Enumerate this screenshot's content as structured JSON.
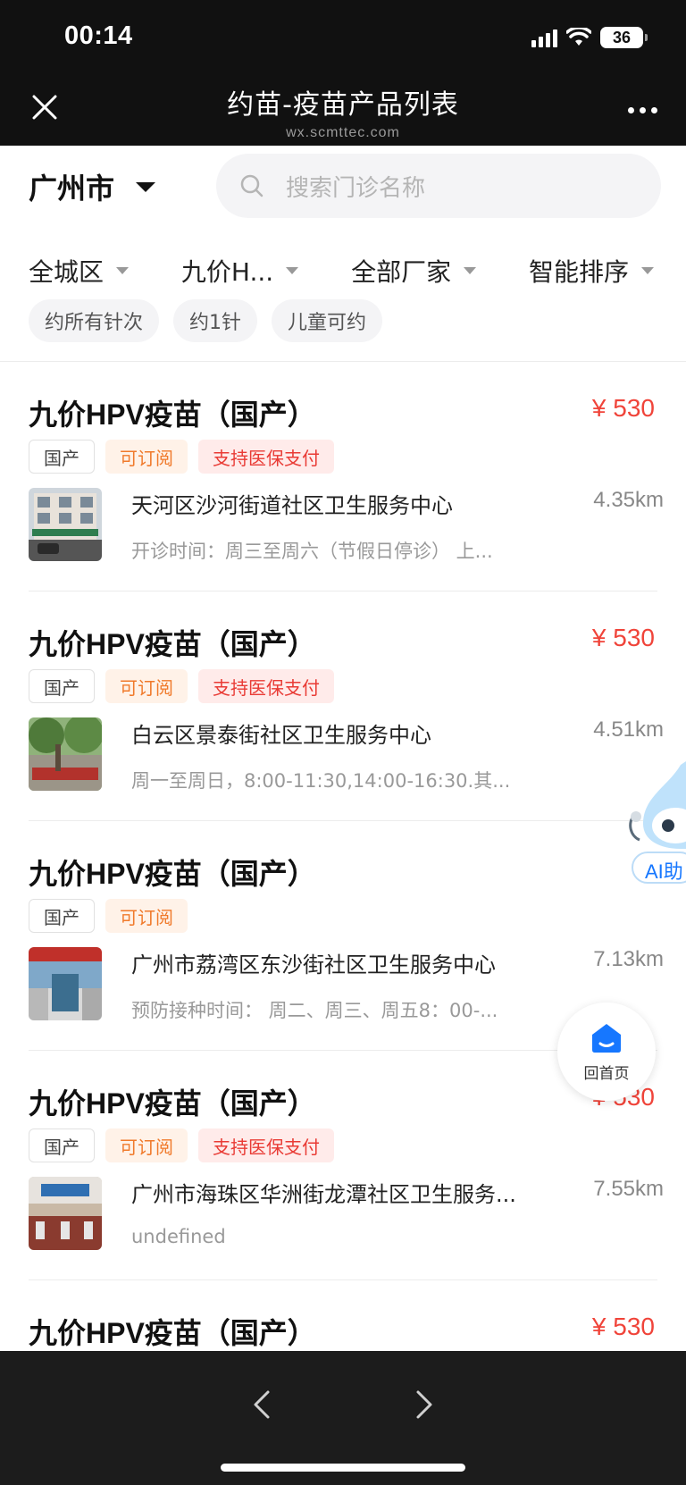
{
  "status_bar": {
    "time": "00:14",
    "battery": "36"
  },
  "header": {
    "title": "约苗-疫苗产品列表",
    "subtitle": "wx.scmttec.com"
  },
  "city": {
    "name": "广州市"
  },
  "search": {
    "placeholder": "搜索门诊名称"
  },
  "filters": [
    {
      "label": "全城区"
    },
    {
      "label": "九价H..."
    },
    {
      "label": "全部厂家"
    },
    {
      "label": "智能排序"
    }
  ],
  "chips": [
    "约所有针次",
    "约1针",
    "儿童可约"
  ],
  "items": [
    {
      "product": "九价HPV疫苗（国产）",
      "price": "¥ 530",
      "tags": [
        "国产",
        "可订阅",
        "支持医保支付"
      ],
      "clinic": "天河区沙河街道社区卫生服务中心",
      "distance": "4.35km",
      "hours": "开诊时间：周三至周六（节假日停诊） 上..."
    },
    {
      "product": "九价HPV疫苗（国产）",
      "price": "¥ 530",
      "tags": [
        "国产",
        "可订阅",
        "支持医保支付"
      ],
      "clinic": "白云区景泰街社区卫生服务中心",
      "distance": "4.51km",
      "hours": "周一至周日，8:00-11:30,14:00-16:30.其..."
    },
    {
      "product": "九价HPV疫苗（国产）",
      "price": "",
      "tags": [
        "国产",
        "可订阅"
      ],
      "clinic": "广州市荔湾区东沙街社区卫生服务中心",
      "distance": "7.13km",
      "hours": "预防接种时间： 周二、周三、周五8：00-..."
    },
    {
      "product": "九价HPV疫苗（国产）",
      "price": "¥ 530",
      "tags": [
        "国产",
        "可订阅",
        "支持医保支付"
      ],
      "clinic": "广州市海珠区华洲街龙潭社区卫生服务...",
      "distance": "7.55km",
      "hours": "undefined"
    },
    {
      "product": "九价HPV疫苗（国产）",
      "price": "¥ 530"
    }
  ],
  "floating": {
    "ai_label": "AI助",
    "home_label": "回首页"
  },
  "colors": {
    "price": "#f0443a",
    "accent_blue": "#1677ff",
    "book_tag": "#f07a2b",
    "insurance_tag": "#e93b35"
  }
}
